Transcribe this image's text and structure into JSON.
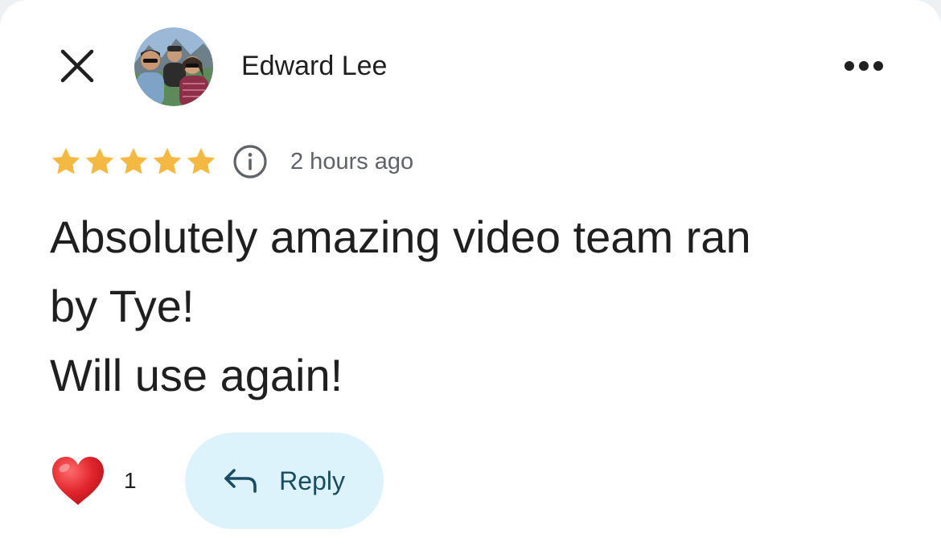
{
  "header": {
    "close_icon": "close-icon",
    "author_name": "Edward Lee",
    "avatar_icon": "profile-photo",
    "more_icon": "more-horizontal-icon"
  },
  "rating": {
    "stars": 5,
    "max_stars": 5,
    "star_color": "#f4b942",
    "info_icon": "info-icon",
    "time_ago": "2 hours ago"
  },
  "review": {
    "lines": [
      "Absolutely amazing video team ran",
      "by Tye!",
      "Will use again!"
    ]
  },
  "actions": {
    "like_icon": "heart-icon",
    "like_color": "#e0242c",
    "like_count": "1",
    "reply_icon": "reply-arrow-icon",
    "reply_label": "Reply",
    "reply_bg": "#dcf3fb"
  }
}
